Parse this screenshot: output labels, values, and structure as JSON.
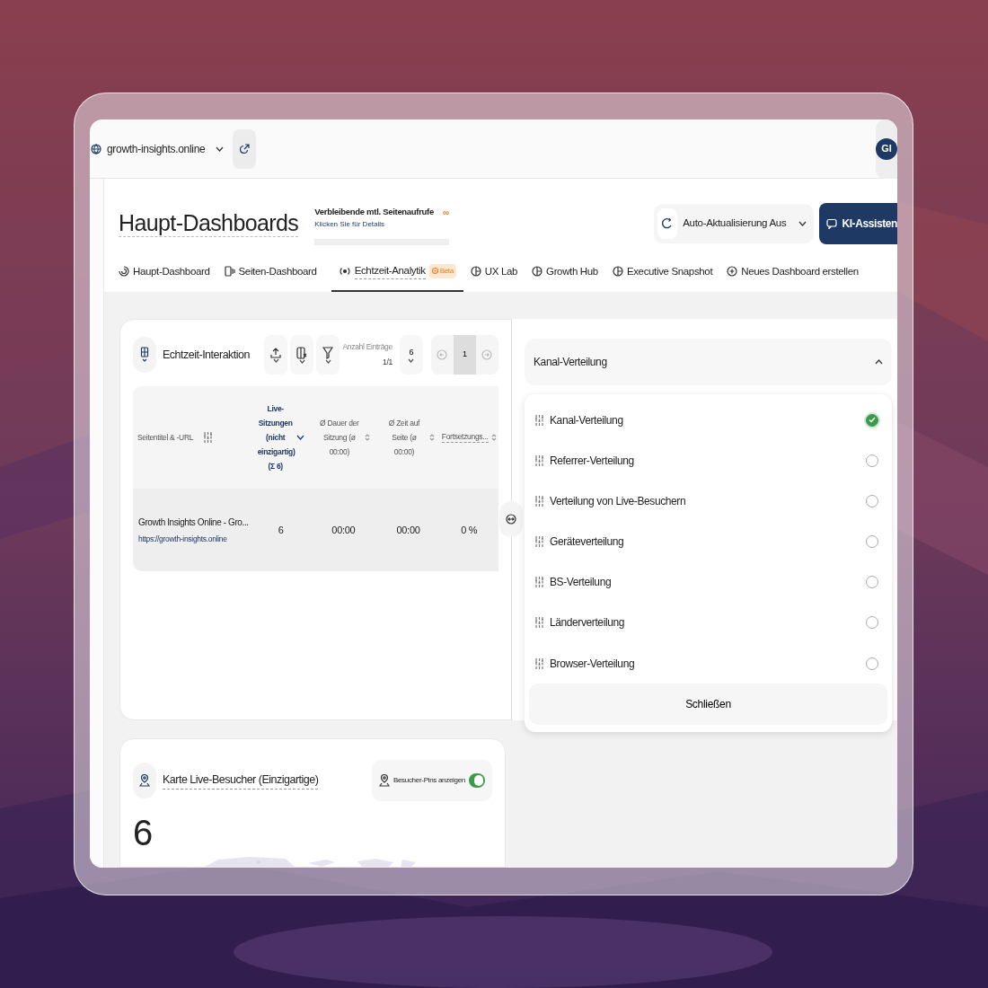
{
  "topbar": {
    "site": "growth-insights.online",
    "avatar": "GI"
  },
  "header": {
    "title": "Haupt-Dashboards",
    "quota_label": "Verbleibende mtl. Seitenaufrufe",
    "quota_link": "Klicken Sie für Details",
    "quota_value": "∞",
    "auto_refresh": "Auto-Aktualisierung Aus",
    "assistant": "KI-Assisten"
  },
  "tabs": [
    {
      "label": "Haupt-Dashboard",
      "kind": "gauge",
      "selected": false
    },
    {
      "label": "Seiten-Dashboard",
      "kind": "page",
      "selected": false
    },
    {
      "label": "Echtzeit-Analytik",
      "kind": "live",
      "selected": true,
      "badge": "Beta"
    },
    {
      "label": "UX Lab",
      "kind": "pie",
      "selected": false
    },
    {
      "label": "Growth Hub",
      "kind": "pie",
      "selected": false
    },
    {
      "label": "Executive Snapshot",
      "kind": "pie",
      "selected": false
    },
    {
      "label": "Neues Dashboard erstellen",
      "kind": "add",
      "selected": false
    }
  ],
  "interaction": {
    "title": "Echtzeit-Interaktion",
    "entries_label": "Anzahl Einträge",
    "entries_pages": "1/1",
    "entries_count": "6",
    "page": "1",
    "columns": [
      {
        "label": "Seitentitel & -URL",
        "kind": "dimension",
        "sorted": false
      },
      {
        "label": "Live-Sitzungen (nicht einzigartig) (Σ 6)",
        "kind": "metric",
        "sorted": true
      },
      {
        "label": "Ø Dauer der Sitzung (ø 00:00)",
        "kind": "metric",
        "sorted": false
      },
      {
        "label": "Ø Zeit auf Seite (ø 00:00)",
        "kind": "metric",
        "sorted": false
      },
      {
        "label": "Fortsetzungs...",
        "kind": "metric",
        "sorted": false
      }
    ],
    "rows": [
      {
        "cells": [
          "Growth Insights Online - Gro...",
          "6",
          "00:00",
          "00:00",
          "0 %"
        ],
        "url": "https://growth-insights.online"
      }
    ]
  },
  "distribution": {
    "value": "Kanal-Verteilung",
    "expanded": true,
    "options": [
      {
        "label": "Kanal-Verteilung",
        "selected": true
      },
      {
        "label": "Referrer-Verteilung",
        "selected": false
      },
      {
        "label": "Verteilung von Live-Besuchern",
        "selected": false
      },
      {
        "label": "Geräteverteilung",
        "selected": false
      },
      {
        "label": "BS-Verteilung",
        "selected": false
      },
      {
        "label": "Länderverteilung",
        "selected": false
      },
      {
        "label": "Browser-Verteilung",
        "selected": false
      }
    ],
    "close": "Schließen"
  },
  "map": {
    "title": "Karte Live-Besucher (Einzigartige)",
    "toggle_label": "Besucher-Pins anzeigen",
    "pins_on": true,
    "count": "6"
  }
}
